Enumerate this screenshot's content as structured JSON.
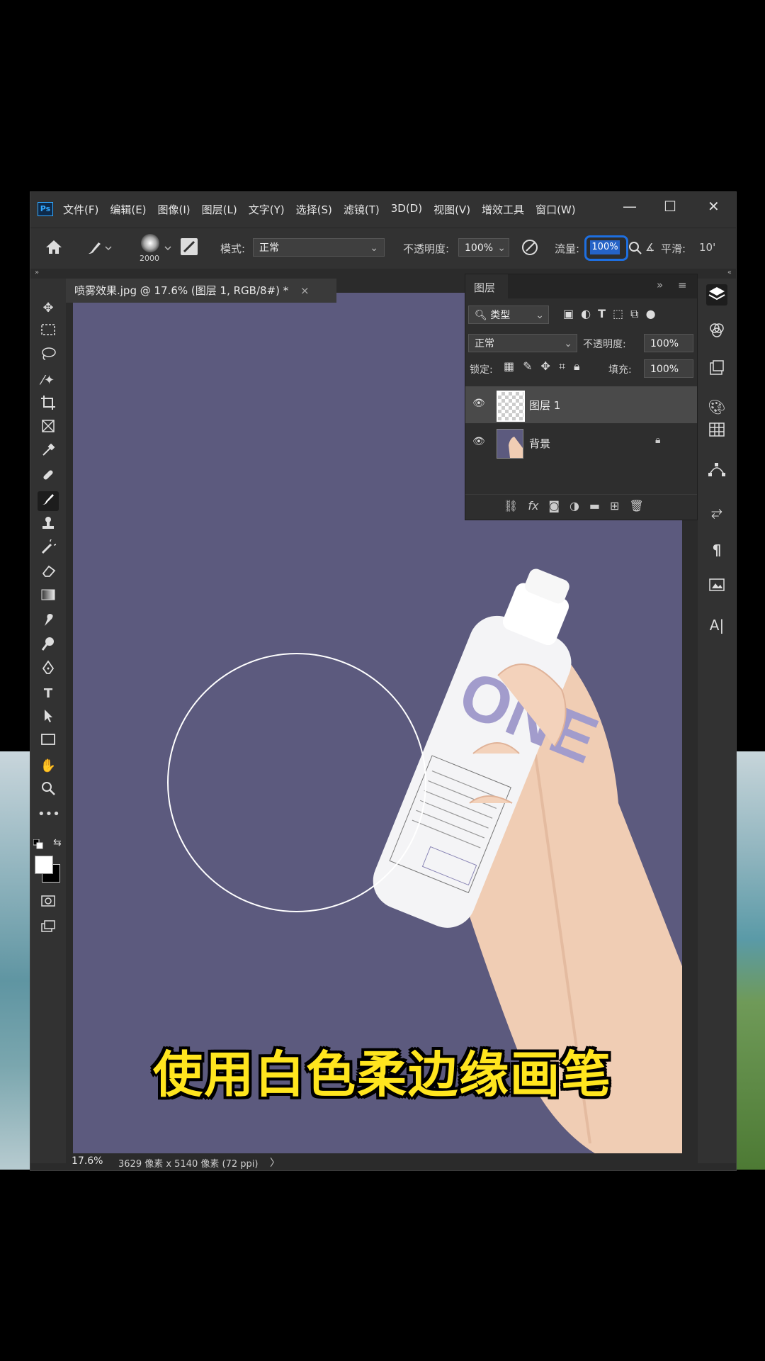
{
  "app": {
    "logo": "Ps",
    "menu": [
      "文件(F)",
      "编辑(E)",
      "图像(I)",
      "图层(L)",
      "文字(Y)",
      "选择(S)",
      "滤镜(T)",
      "3D(D)",
      "视图(V)",
      "增效工具",
      "窗口(W)"
    ],
    "window_controls": {
      "minimize": "—",
      "maximize": "☐",
      "close": "✕"
    }
  },
  "options": {
    "brush_size": "2000",
    "mode_label": "模式:",
    "mode_value": "正常",
    "opacity_label": "不透明度:",
    "opacity_value": "100%",
    "flow_label": "流量:",
    "flow_value": "100%",
    "smoothing_label": "平滑:",
    "smoothing_value": "10'"
  },
  "document": {
    "tab_title": "喷雾效果.jpg @ 17.6% (图层 1, RGB/8#) *",
    "tab_close": "×"
  },
  "status": {
    "zoom": "17.6%",
    "info": "3629 像素 x 5140 像素 (72 ppi)",
    "arrow": "〉"
  },
  "layers_panel": {
    "title": "图层",
    "filter_label": "类型",
    "blend_mode": "正常",
    "opacity_label": "不透明度:",
    "opacity_value": "100%",
    "lock_label": "锁定:",
    "fill_label": "填充:",
    "fill_value": "100%",
    "layers": [
      {
        "name": "图层 1",
        "selected": true
      },
      {
        "name": "背景",
        "locked": true
      }
    ]
  },
  "caption": "使用白色柔边缘画笔",
  "colors": {
    "canvas_bg": "#5c5a7e",
    "accent_highlight": "#1e6fe0",
    "caption": "#ffe51e"
  }
}
